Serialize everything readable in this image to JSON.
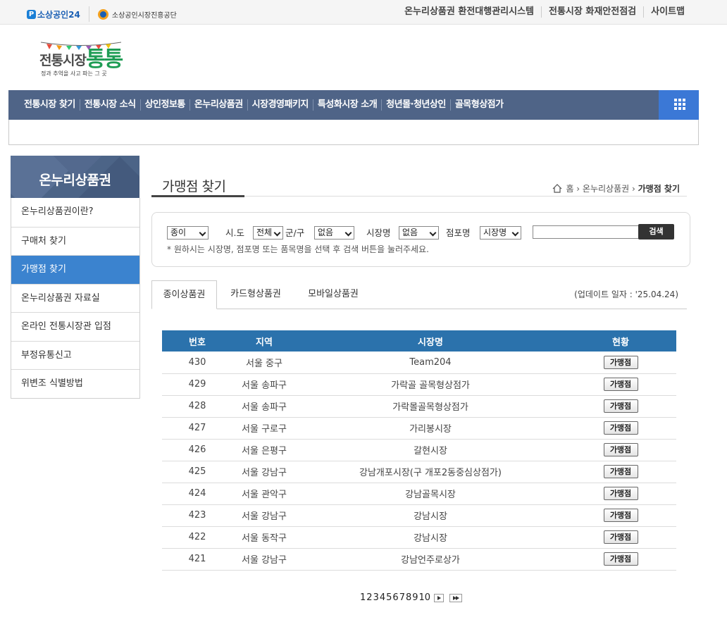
{
  "topbar": {
    "brand1": "소상공인24",
    "brand2": "소상공인시장진흥공단",
    "links": [
      "온누리상품권 환전대행관리시스템",
      "전통시장 화재안전점검",
      "사이트맵"
    ]
  },
  "site_logo": {
    "line1": "전통시장",
    "line2": "통통",
    "tagline": "정과 추억을 사고 파는 그 곳"
  },
  "gnb": [
    "전통시장 찾기",
    "전통시장 소식",
    "상인정보통",
    "온누리상품권",
    "시장경영패키지",
    "특성화시장 소개",
    "청년몰·청년상인",
    "골목형상점가"
  ],
  "lnb": {
    "title": "온누리상품권",
    "items": [
      "온누리상품권이란?",
      "구매처 찾기",
      "가맹점 찾기",
      "온누리상품권 자료실",
      "온라인 전통시장관 입점",
      "부정유통신고",
      "위변조 식별방법"
    ],
    "active_index": 2
  },
  "page": {
    "title": "가맹점 찾기",
    "breadcrumb": [
      "홈",
      "온누리상품권",
      "가맹점 찾기"
    ]
  },
  "search": {
    "type_value": "종이",
    "sido_label": "시.도",
    "sido_value": "전체",
    "gungu_label": "군/구",
    "gungu_value": "없음",
    "market_label": "시장명",
    "market_value": "없음",
    "store_label": "점포명",
    "store_value": "시장명",
    "keyword": "",
    "button": "검색",
    "hint": "* 원하시는 시장명, 점포명 또는 품목명을 선택 후 검색 버튼을 눌러주세요."
  },
  "tabs": [
    "종이상품권",
    "카드형상품권",
    "모바일상품권"
  ],
  "update_text": "(업데이트 일자 : '25.04.24)",
  "table": {
    "headers": [
      "번호",
      "지역",
      "시장명",
      "현황"
    ],
    "rows": [
      {
        "no": "430",
        "region": "서울 중구",
        "market": "Team204",
        "btn": "가맹점"
      },
      {
        "no": "429",
        "region": "서울 송파구",
        "market": "가락골 골목형상점가",
        "btn": "가맹점"
      },
      {
        "no": "428",
        "region": "서울 송파구",
        "market": "가락몰골목형상점가",
        "btn": "가맹점"
      },
      {
        "no": "427",
        "region": "서울 구로구",
        "market": "가리봉시장",
        "btn": "가맹점"
      },
      {
        "no": "426",
        "region": "서울 은평구",
        "market": "갈현시장",
        "btn": "가맹점"
      },
      {
        "no": "425",
        "region": "서울 강남구",
        "market": "강남개포시장(구 개포2동중심상점가)",
        "btn": "가맹점"
      },
      {
        "no": "424",
        "region": "서울 관악구",
        "market": "강남골목시장",
        "btn": "가맹점"
      },
      {
        "no": "423",
        "region": "서울 강남구",
        "market": "강남시장",
        "btn": "가맹점"
      },
      {
        "no": "422",
        "region": "서울 동작구",
        "market": "강남시장",
        "btn": "가맹점"
      },
      {
        "no": "421",
        "region": "서울 강남구",
        "market": "강남언주로상가",
        "btn": "가맹점"
      }
    ]
  },
  "pager": [
    "1",
    "2",
    "3",
    "4",
    "5",
    "6",
    "7",
    "8",
    "9",
    "10"
  ]
}
